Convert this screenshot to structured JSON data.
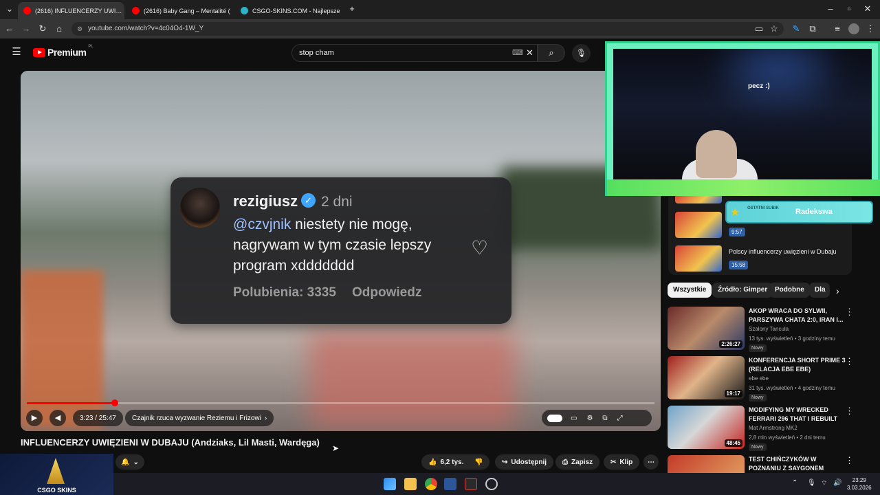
{
  "browser": {
    "tabs": [
      {
        "title": "(2616) INFLUENCERZY UWI…",
        "active": true
      },
      {
        "title": "(2616) Baby Gang – Mentalité (",
        "active": false
      },
      {
        "title": "CSGO-SKINS.COM - Najlepsze",
        "active": false
      }
    ],
    "url": "youtube.com/watch?v=4c04O4-1W_Y"
  },
  "youtube": {
    "logo_text": "Premium",
    "logo_region": "PL",
    "search_value": "stop cham"
  },
  "player": {
    "comment": {
      "username": "rezigiusz",
      "time": "2 dni",
      "mention": "@czvjnik",
      "text": " niestety nie mogę, nagrywam w tym czasie lepszy program xddddddd",
      "likes": "Polubienia: 3335",
      "reply": "Odpowiedz"
    },
    "time_display": "3:23 / 25:47",
    "progress_fraction": 0.14,
    "chapter": "Czajnik rzuca wyzwanie Reziemu i Frizowi"
  },
  "video": {
    "title": "INFLUENCERZY UWIĘZIENI W DUBAJU (Andziaks, Lil Masti, Wardęga)",
    "likes": "6,2 tys.",
    "share": "Udostępnij",
    "save": "Zapisz",
    "clip": "Klip"
  },
  "overlay": {
    "cam_text": "pecz :)",
    "sub_label": "OSTATNI SUBIK",
    "sub_name": "Radekswa"
  },
  "playlist": {
    "items": [
      {
        "duration": "9:57",
        "title": ""
      },
      {
        "duration": "15:58",
        "title": "Polscy influencerzy uwięzieni w Dubaju"
      }
    ]
  },
  "chips": [
    "Wszystkie",
    "Źródło: Gimper",
    "Podobne",
    "Dla"
  ],
  "recommendations": [
    {
      "title": "AKOP WRACA DO SYLWII, PARSZYWA CHATA 2:0, IRAN I...",
      "channel": "Szalony Tancula",
      "meta": "13 tys. wyświetleń • 3 godziny temu",
      "badge": "Nowy",
      "duration": "2:26:27"
    },
    {
      "title": "KONFERENCJA SHORT PRIME 3 (RELACJA EBE EBE)",
      "channel": "ebe ebe",
      "meta": "31 tys. wyświetleń • 4 godziny temu",
      "badge": "Nowy",
      "duration": "19:17"
    },
    {
      "title": "MODIFYING MY WRECKED FERRARI 296 THAT I REBUILT",
      "channel": "Mat Armstrong MK2",
      "meta": "2,8 mln wyświetleń • 2 dni temu",
      "badge": "Nowy",
      "duration": "48:45"
    },
    {
      "title": "TEST CHIŃCZYKÓW W POZNANIU Z SAYGONEM",
      "channel": "",
      "meta": "",
      "badge": "",
      "duration": ""
    }
  ],
  "taskbar": {
    "time": "23:29",
    "date": "3.03.2026",
    "overlay_brand": "CSGO SKINS"
  }
}
